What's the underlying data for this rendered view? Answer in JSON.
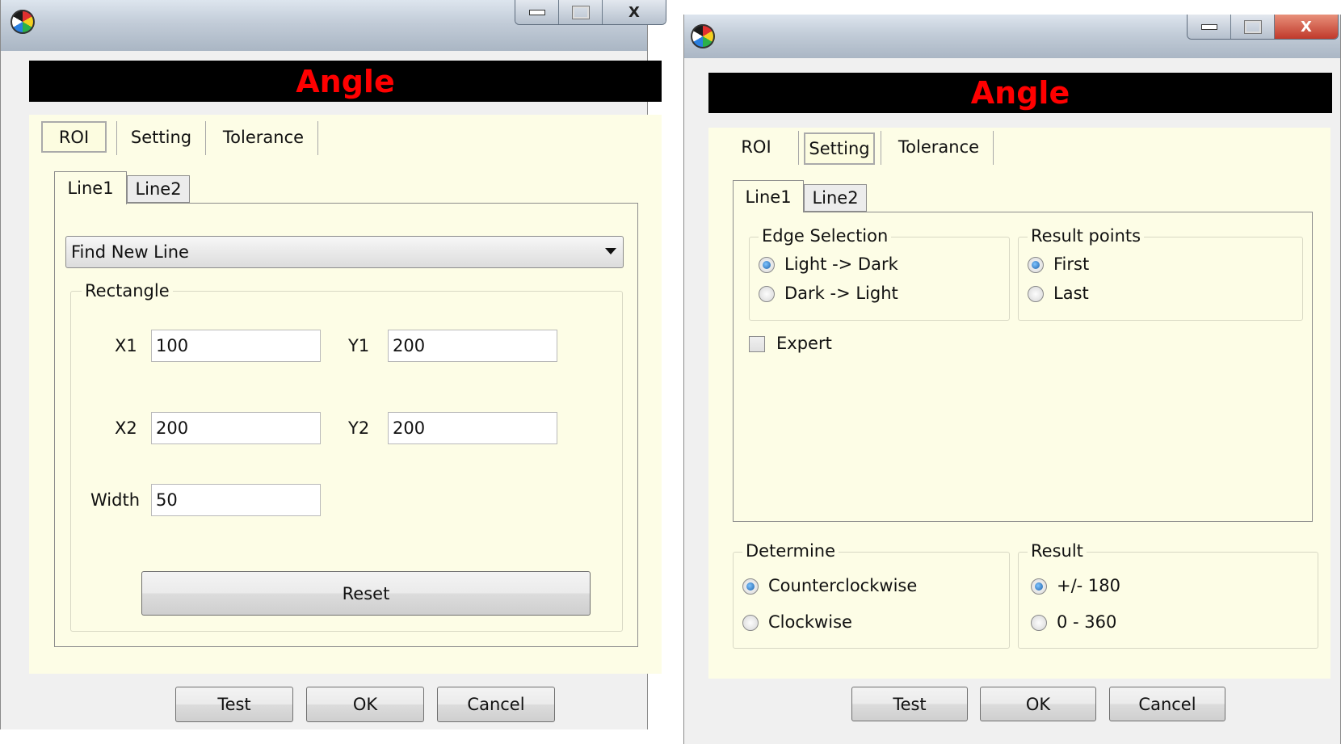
{
  "left_dialog": {
    "header_title": "Angle",
    "tabs": [
      "ROI",
      "Setting",
      "Tolerance"
    ],
    "selected_tab": "ROI",
    "line_tabs": [
      "Line1",
      "Line2"
    ],
    "selected_line_tab": "Line1",
    "mode_dropdown": "Find New Line",
    "rectangle_group": "Rectangle",
    "x1_label": "X1",
    "x1_value": "100",
    "y1_label": "Y1",
    "y1_value": "200",
    "x2_label": "X2",
    "x2_value": "200",
    "y2_label": "Y2",
    "y2_value": "200",
    "width_label": "Width",
    "width_value": "50",
    "reset_button": "Reset",
    "buttons": {
      "test": "Test",
      "ok": "OK",
      "cancel": "Cancel"
    },
    "close_glyph": "X"
  },
  "right_dialog": {
    "header_title": "Angle",
    "tabs": [
      "ROI",
      "Setting",
      "Tolerance"
    ],
    "selected_tab": "Setting",
    "line_tabs": [
      "Line1",
      "Line2"
    ],
    "selected_line_tab": "Line1",
    "edge_selection": {
      "title": "Edge Selection",
      "options": [
        "Light -> Dark",
        "Dark -> Light"
      ],
      "selected": "Light -> Dark"
    },
    "result_points": {
      "title": "Result points",
      "options": [
        "First",
        "Last"
      ],
      "selected": "First"
    },
    "expert_label": "Expert",
    "expert_checked": false,
    "determine": {
      "title": "Determine",
      "options": [
        "Counterclockwise",
        "Clockwise"
      ],
      "selected": "Counterclockwise"
    },
    "result": {
      "title": "Result",
      "options": [
        "+/- 180",
        "0 - 360"
      ],
      "selected": "+/- 180"
    },
    "buttons": {
      "test": "Test",
      "ok": "OK",
      "cancel": "Cancel"
    },
    "close_glyph": "X"
  },
  "colors": {
    "header_bg": "#000000",
    "header_text": "#ff0000",
    "panel_bg": "#fdfde6"
  },
  "icons": [
    "app-icon",
    "minimize-icon",
    "maximize-icon",
    "close-icon",
    "dropdown-arrow-icon"
  ]
}
